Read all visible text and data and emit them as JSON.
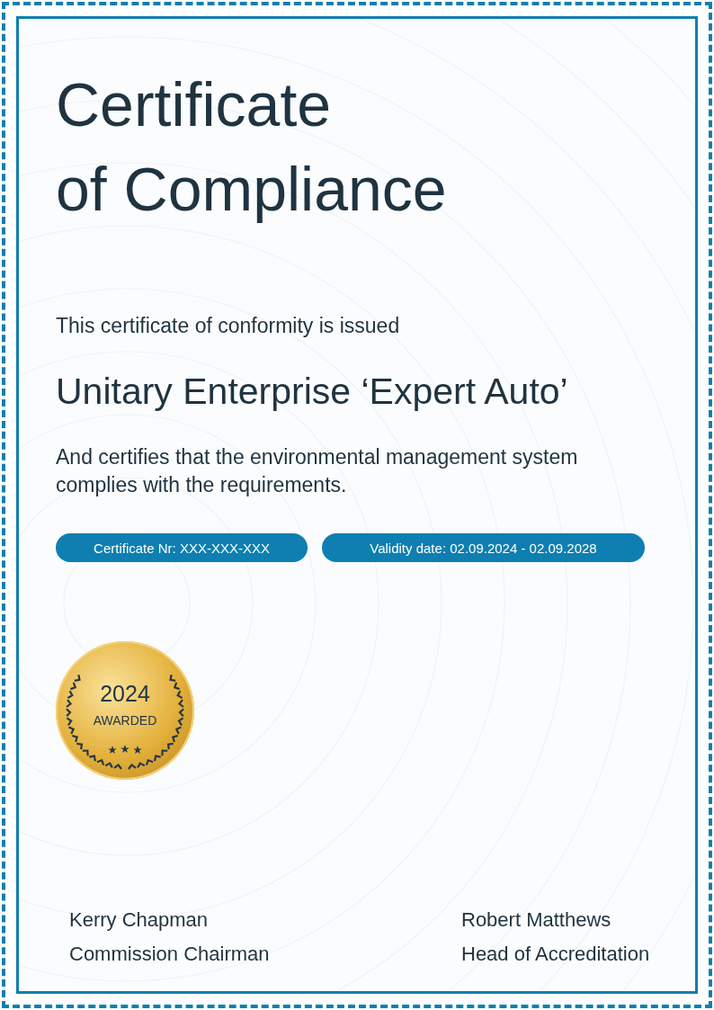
{
  "title_lines": [
    "Certificate",
    "of Compliance"
  ],
  "intro": "This certificate of conformity is issued",
  "recipient": "Unitary Enterprise ‘Expert Auto’",
  "statement": "And certifies that the environmental management system complies with the requirements.",
  "badges": [
    "Certificate Nr: XXX-XXX-XXX",
    "Validity date: 02.09.2024 - 02.09.2028"
  ],
  "medal": {
    "year": "2024",
    "label": "AWARDED"
  },
  "signatories": [
    {
      "name": "Kerry Chapman",
      "role": "Commission Chairman"
    },
    {
      "name": "Robert Matthews",
      "role": "Head of Accreditation"
    }
  ]
}
